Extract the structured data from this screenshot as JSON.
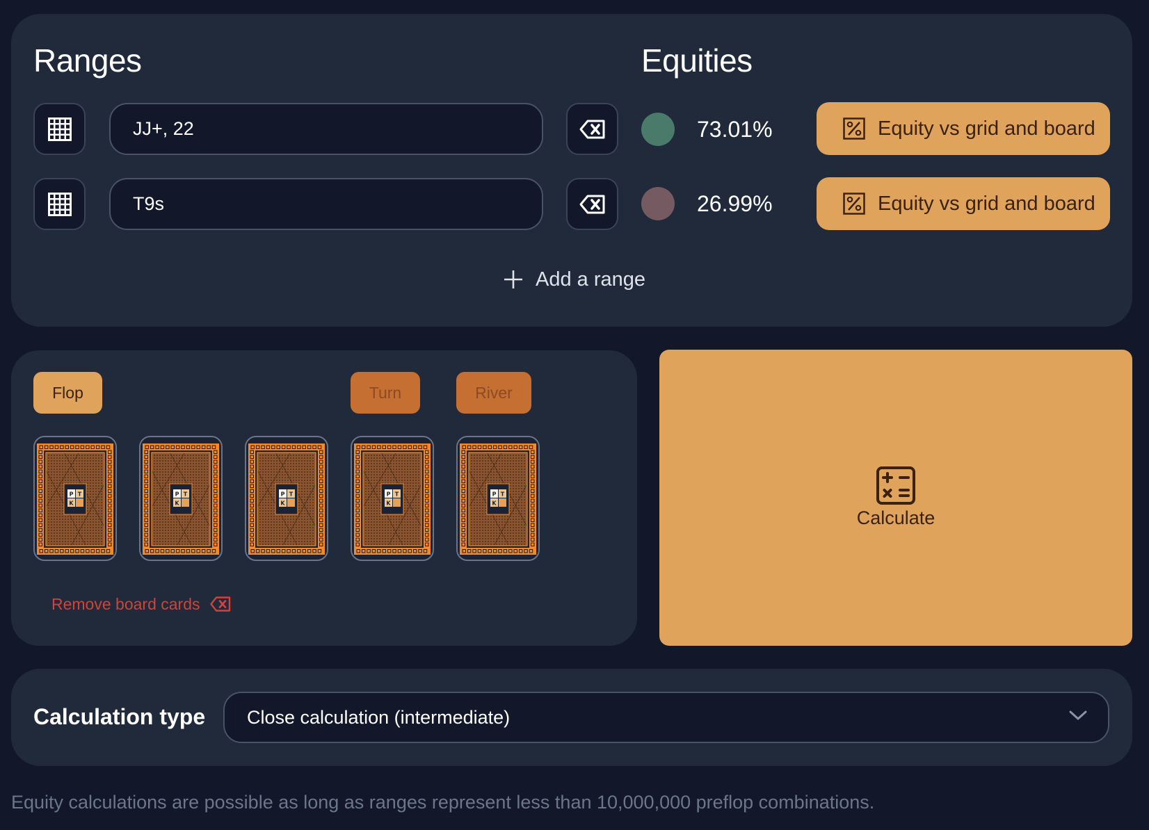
{
  "ranges_section": {
    "title": "Ranges",
    "rows": [
      {
        "value": "JJ+, 22",
        "grid_icon": "grid-icon",
        "clear_icon": "backspace-icon"
      },
      {
        "value": "T9s",
        "grid_icon": "grid-icon",
        "clear_icon": "backspace-icon"
      }
    ],
    "add_range_label": "Add a range",
    "add_range_icon": "plus-icon"
  },
  "equities_section": {
    "title": "Equities",
    "rows": [
      {
        "equity": "73.01%",
        "color": "#4a7a6a",
        "button_label": "Equity vs grid and board",
        "button_icon": "percent-icon"
      },
      {
        "equity": "26.99%",
        "color": "#765a62",
        "button_label": "Equity vs grid and board",
        "button_icon": "percent-icon"
      }
    ]
  },
  "board": {
    "streets": [
      {
        "label": "Flop",
        "active": true
      },
      {
        "label": "Turn",
        "active": false
      },
      {
        "label": "River",
        "active": false
      }
    ],
    "cards": [
      {
        "state": "face-down",
        "logo": [
          "P",
          "T",
          "K"
        ]
      },
      {
        "state": "face-down",
        "logo": [
          "P",
          "T",
          "K"
        ]
      },
      {
        "state": "face-down",
        "logo": [
          "P",
          "T",
          "K"
        ]
      },
      {
        "state": "face-down",
        "logo": [
          "P",
          "T",
          "K"
        ]
      },
      {
        "state": "face-down",
        "logo": [
          "P",
          "T",
          "K"
        ]
      }
    ],
    "remove_label": "Remove board cards",
    "remove_icon": "backspace-icon"
  },
  "calculate": {
    "label": "Calculate",
    "icon": "calculator-icon"
  },
  "calculation_type": {
    "label": "Calculation type",
    "selected": "Close calculation (intermediate)",
    "icon": "chevron-down-icon"
  },
  "footnote": "Equity calculations are possible as long as ranges represent less than 10,000,000 preflop combinations.",
  "colors": {
    "accent": "#e0a35c",
    "accent_dim": "#c56f32",
    "danger": "#d0433a",
    "panel": "#202a3b",
    "background": "#121829"
  }
}
